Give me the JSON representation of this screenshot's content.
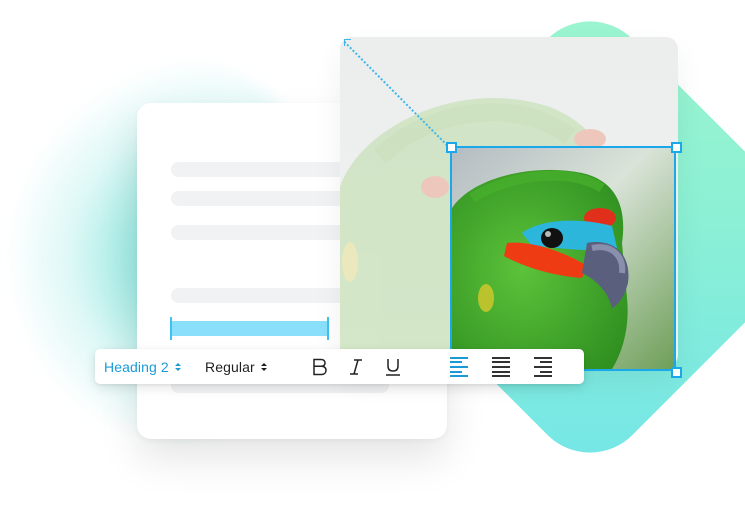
{
  "toolbar": {
    "heading_select": {
      "value": "Heading 2"
    },
    "weight_select": {
      "value": "Regular"
    },
    "format_buttons": [
      {
        "name": "bold",
        "icon": "bold-icon",
        "glyph": "B",
        "active": false
      },
      {
        "name": "italic",
        "icon": "italic-icon",
        "glyph": "I",
        "active": false
      },
      {
        "name": "underline",
        "icon": "underline-icon",
        "glyph": "U",
        "active": false
      }
    ],
    "align_buttons": [
      {
        "name": "align-left",
        "icon": "align-left-icon",
        "active": true
      },
      {
        "name": "align-justify",
        "icon": "align-justify-icon",
        "active": false
      },
      {
        "name": "align-right",
        "icon": "align-right-icon",
        "active": false
      }
    ]
  },
  "image": {
    "subject": "parrot photo",
    "crop_selected": true
  },
  "colors": {
    "accent": "#1a9bd7",
    "selection_highlight": "#8ae0fa",
    "crop_border": "#1aa8ea",
    "icon_default": "#333333",
    "backdrop_mint": "#9cf5cf",
    "backdrop_cyan": "#74e6e8"
  }
}
